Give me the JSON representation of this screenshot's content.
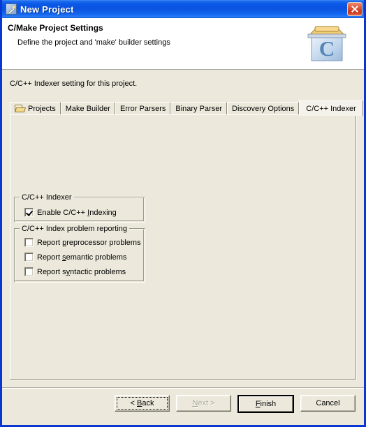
{
  "window": {
    "title": "New Project",
    "title_icon": "wizard-wand-icon",
    "close_label": "Close",
    "border_color": "#0a36d2",
    "titlebar_color": "#0a52e0"
  },
  "header": {
    "title": "C/Make Project Settings",
    "subtitle": "Define the project and 'make' builder settings",
    "icon": "c-project-folder-icon"
  },
  "content": {
    "intro": "C/C++ Indexer setting for this project.",
    "background_color": "#ece9dc"
  },
  "tabs": [
    {
      "label": "Projects",
      "icon": "folder-icon",
      "active": false
    },
    {
      "label": "Make Builder",
      "icon": null,
      "active": false
    },
    {
      "label": "Error Parsers",
      "icon": null,
      "active": false
    },
    {
      "label": "Binary Parser",
      "icon": null,
      "active": false
    },
    {
      "label": "Discovery Options",
      "icon": null,
      "active": false
    },
    {
      "label": "C/C++ Indexer",
      "icon": null,
      "active": true
    }
  ],
  "groups": [
    {
      "title": "C/C++ Indexer",
      "checkboxes": [
        {
          "label": "Enable C/C++ Indexing",
          "mnemonic_before": "Enable C/C++ ",
          "mnemonic": "I",
          "mnemonic_after": "ndexing",
          "checked": true
        }
      ]
    },
    {
      "title": "C/C++ Index problem reporting",
      "checkboxes": [
        {
          "label": "Report preprocessor problems",
          "mnemonic_before": "Report ",
          "mnemonic": "p",
          "mnemonic_after": "reprocessor problems",
          "checked": false
        },
        {
          "label": "Report semantic problems",
          "mnemonic_before": "Report ",
          "mnemonic": "s",
          "mnemonic_after": "emantic problems",
          "checked": false
        },
        {
          "label": "Report syntactic problems",
          "mnemonic_before": "Report s",
          "mnemonic": "y",
          "mnemonic_after": "ntactic problems",
          "checked": false
        }
      ]
    }
  ],
  "buttons": {
    "back": {
      "label": "< Back",
      "mnemonic_before": "< ",
      "mnemonic": "B",
      "mnemonic_after": "ack",
      "enabled": true,
      "focused": true,
      "default": false
    },
    "next": {
      "label": "Next >",
      "mnemonic_before": "",
      "mnemonic": "N",
      "mnemonic_after": "ext >",
      "enabled": false,
      "focused": false,
      "default": false
    },
    "finish": {
      "label": "Finish",
      "mnemonic_before": "",
      "mnemonic": "F",
      "mnemonic_after": "inish",
      "enabled": true,
      "focused": false,
      "default": true
    },
    "cancel": {
      "label": "Cancel",
      "mnemonic_before": "Cancel",
      "mnemonic": "",
      "mnemonic_after": "",
      "enabled": true,
      "focused": false,
      "default": false
    }
  }
}
